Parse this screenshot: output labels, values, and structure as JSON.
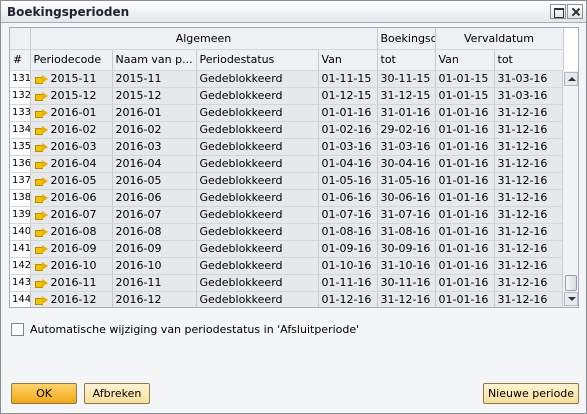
{
  "window": {
    "title": "Boekingsperioden"
  },
  "grid": {
    "group_headers": {
      "general": "Algemeen",
      "posting_date": "Boekingsdatum",
      "due_date": "Vervaldatum"
    },
    "columns": {
      "num": "#",
      "period_code": "Periodecode",
      "name": "Naam van p...",
      "status": "Periodestatus",
      "post_from": "Van",
      "post_to": "tot",
      "due_from": "Van",
      "due_to": "tot"
    },
    "rows": [
      {
        "num": "131",
        "code": "2015-11",
        "name": "2015-11",
        "status": "Gedeblokkeerd",
        "pfrom": "01-11-15",
        "pto": "30-11-15",
        "dfrom": "01-01-15",
        "dto": "31-03-16"
      },
      {
        "num": "132",
        "code": "2015-12",
        "name": "2015-12",
        "status": "Gedeblokkeerd",
        "pfrom": "01-12-15",
        "pto": "31-12-15",
        "dfrom": "01-01-15",
        "dto": "31-03-16"
      },
      {
        "num": "133",
        "code": "2016-01",
        "name": "2016-01",
        "status": "Gedeblokkeerd",
        "pfrom": "01-01-16",
        "pto": "31-01-16",
        "dfrom": "01-01-16",
        "dto": "31-12-16"
      },
      {
        "num": "134",
        "code": "2016-02",
        "name": "2016-02",
        "status": "Gedeblokkeerd",
        "pfrom": "01-02-16",
        "pto": "29-02-16",
        "dfrom": "01-01-16",
        "dto": "31-12-16"
      },
      {
        "num": "135",
        "code": "2016-03",
        "name": "2016-03",
        "status": "Gedeblokkeerd",
        "pfrom": "01-03-16",
        "pto": "31-03-16",
        "dfrom": "01-01-16",
        "dto": "31-12-16"
      },
      {
        "num": "136",
        "code": "2016-04",
        "name": "2016-04",
        "status": "Gedeblokkeerd",
        "pfrom": "01-04-16",
        "pto": "30-04-16",
        "dfrom": "01-01-16",
        "dto": "31-12-16"
      },
      {
        "num": "137",
        "code": "2016-05",
        "name": "2016-05",
        "status": "Gedeblokkeerd",
        "pfrom": "01-05-16",
        "pto": "31-05-16",
        "dfrom": "01-01-16",
        "dto": "31-12-16"
      },
      {
        "num": "138",
        "code": "2016-06",
        "name": "2016-06",
        "status": "Gedeblokkeerd",
        "pfrom": "01-06-16",
        "pto": "30-06-16",
        "dfrom": "01-01-16",
        "dto": "31-12-16"
      },
      {
        "num": "139",
        "code": "2016-07",
        "name": "2016-07",
        "status": "Gedeblokkeerd",
        "pfrom": "01-07-16",
        "pto": "31-07-16",
        "dfrom": "01-01-16",
        "dto": "31-12-16"
      },
      {
        "num": "140",
        "code": "2016-08",
        "name": "2016-08",
        "status": "Gedeblokkeerd",
        "pfrom": "01-08-16",
        "pto": "31-08-16",
        "dfrom": "01-01-16",
        "dto": "31-12-16"
      },
      {
        "num": "141",
        "code": "2016-09",
        "name": "2016-09",
        "status": "Gedeblokkeerd",
        "pfrom": "01-09-16",
        "pto": "30-09-16",
        "dfrom": "01-01-16",
        "dto": "31-12-16"
      },
      {
        "num": "142",
        "code": "2016-10",
        "name": "2016-10",
        "status": "Gedeblokkeerd",
        "pfrom": "01-10-16",
        "pto": "31-10-16",
        "dfrom": "01-01-16",
        "dto": "31-12-16"
      },
      {
        "num": "143",
        "code": "2016-11",
        "name": "2016-11",
        "status": "Gedeblokkeerd",
        "pfrom": "01-11-16",
        "pto": "30-11-16",
        "dfrom": "01-01-16",
        "dto": "31-12-16"
      },
      {
        "num": "144",
        "code": "2016-12",
        "name": "2016-12",
        "status": "Gedeblokkeerd",
        "pfrom": "01-12-16",
        "pto": "31-12-16",
        "dfrom": "01-01-16",
        "dto": "31-12-16"
      }
    ],
    "row_icon": "arrow-right-icon"
  },
  "auto_change": {
    "label": "Automatische wijziging van periodestatus in 'Afsluitperiode'",
    "checked": false
  },
  "buttons": {
    "ok": "OK",
    "cancel": "Afbreken",
    "new_period": "Nieuwe periode"
  },
  "colors": {
    "button_primary": "#f0a818",
    "button_secondary": "#f7df9c",
    "row_arrow": "#f2c200"
  }
}
